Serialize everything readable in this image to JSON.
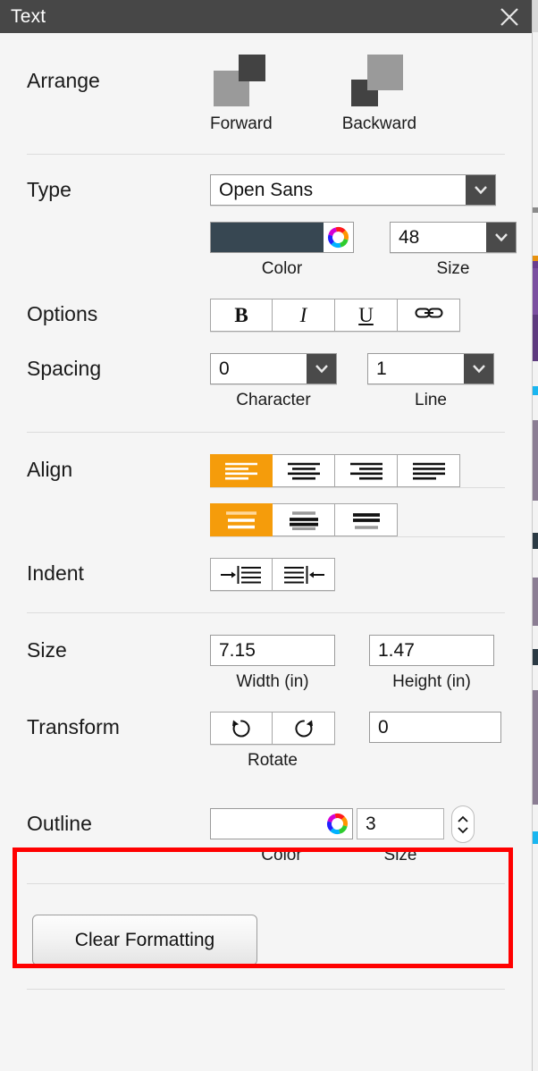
{
  "window": {
    "title": "Text",
    "close_icon": "close-icon"
  },
  "sections": {
    "arrange": {
      "label": "Arrange",
      "items": [
        {
          "label": "Forward",
          "icon": "bring-forward-icon"
        },
        {
          "label": "Backward",
          "icon": "send-backward-icon"
        }
      ]
    },
    "type": {
      "label": "Type",
      "font": {
        "value": "Open Sans",
        "icon": "chevron-down-icon"
      },
      "color": {
        "caption": "Color",
        "value": "#374752",
        "icon": "color-wheel-icon"
      },
      "size": {
        "caption": "Size",
        "value": "48",
        "icon": "chevron-down-icon"
      }
    },
    "options": {
      "label": "Options",
      "buttons": [
        {
          "name": "bold",
          "glyph": "B"
        },
        {
          "name": "italic",
          "glyph": "I"
        },
        {
          "name": "underline",
          "glyph": "U"
        },
        {
          "name": "link",
          "glyph": "link-icon"
        }
      ]
    },
    "spacing": {
      "label": "Spacing",
      "character": {
        "caption": "Character",
        "value": "0",
        "icon": "chevron-down-icon"
      },
      "line": {
        "caption": "Line",
        "value": "1",
        "icon": "chevron-down-icon"
      }
    },
    "align": {
      "label": "Align",
      "horizontal": [
        {
          "name": "align-left",
          "active": true
        },
        {
          "name": "align-center",
          "active": false
        },
        {
          "name": "align-right",
          "active": false
        },
        {
          "name": "align-justify",
          "active": false
        }
      ],
      "vertical": [
        {
          "name": "align-top",
          "active": true
        },
        {
          "name": "align-middle",
          "active": false
        },
        {
          "name": "align-bottom",
          "active": false
        }
      ]
    },
    "indent": {
      "label": "Indent",
      "buttons": [
        {
          "name": "indent-increase"
        },
        {
          "name": "indent-decrease"
        }
      ]
    },
    "size": {
      "label": "Size",
      "width": {
        "caption": "Width (in)",
        "value": "7.15"
      },
      "height": {
        "caption": "Height (in)",
        "value": "1.47"
      }
    },
    "transform": {
      "label": "Transform",
      "rotate_caption": "Rotate",
      "buttons": [
        {
          "name": "rotate-counterclockwise"
        },
        {
          "name": "rotate-clockwise"
        }
      ],
      "angle": {
        "value": "0"
      }
    },
    "outline": {
      "label": "Outline",
      "color": {
        "caption": "Color",
        "value": "#ffffff",
        "icon": "color-wheel-icon"
      },
      "size": {
        "caption": "Size",
        "value": "3",
        "icon": "stepper-icon"
      }
    },
    "clear": {
      "label": "Clear Formatting"
    }
  },
  "colors": {
    "accent": "#f59c0b",
    "titlebar": "#474747",
    "panel_bg": "#f5f5f5",
    "highlight": "#ff0000",
    "text_color_swatch": "#374752"
  }
}
